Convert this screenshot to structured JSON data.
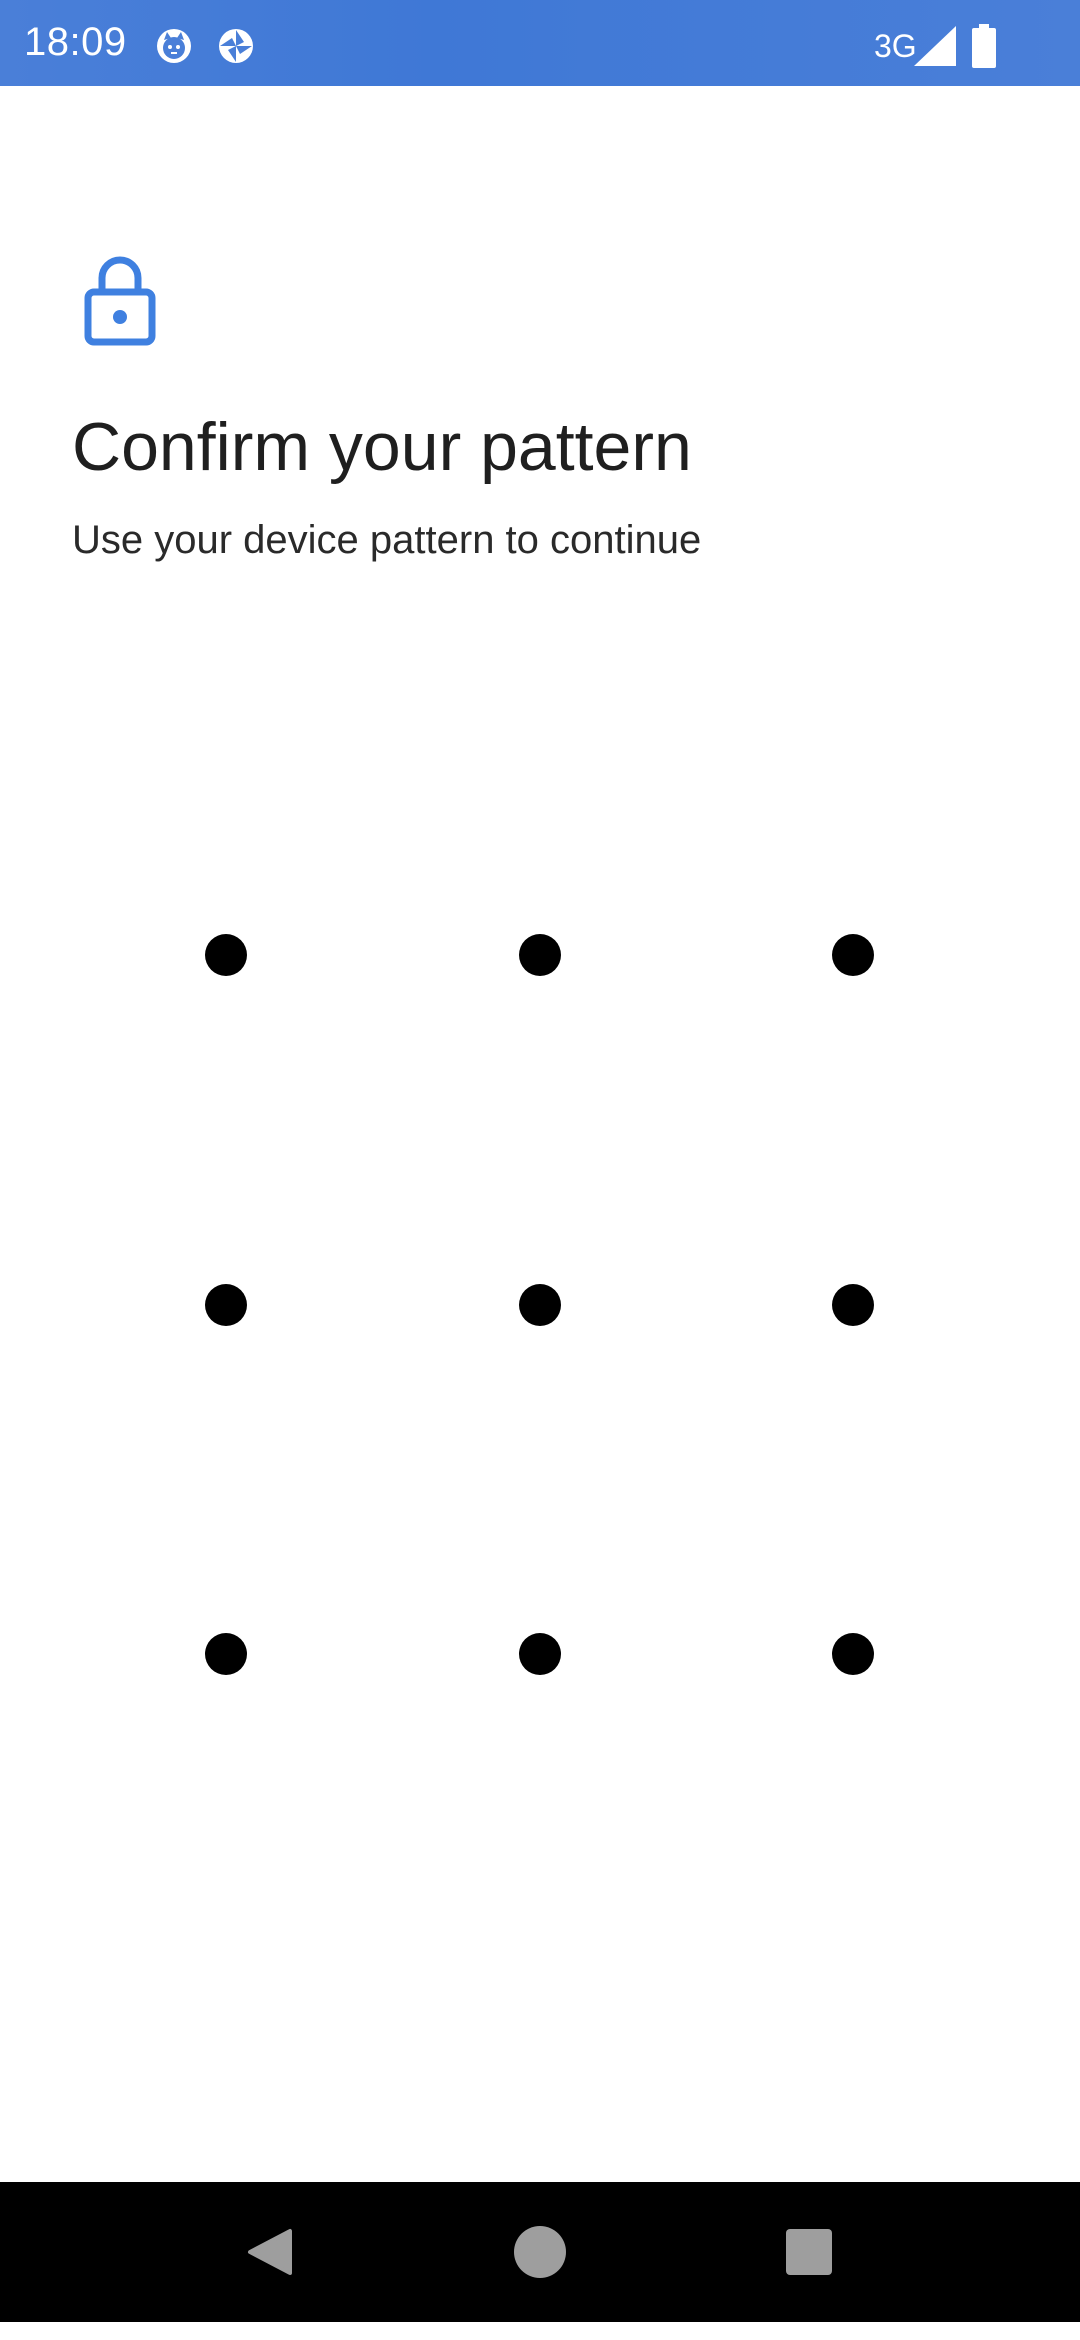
{
  "status_bar": {
    "time": "18:09",
    "network": "3G",
    "icons": [
      "cat-notification-icon",
      "sync-app-icon",
      "signal-icon",
      "battery-icon"
    ],
    "background_color": "#4a7fd8"
  },
  "header": {
    "icon": "lock-icon",
    "icon_color": "#3f80e0",
    "title": "Confirm your pattern",
    "subtitle": "Use your device pattern to continue"
  },
  "pattern": {
    "rows": 3,
    "columns": 3,
    "dot_color": "#000000"
  },
  "nav_bar": {
    "buttons": [
      "back-icon",
      "home-icon",
      "recents-icon"
    ]
  }
}
